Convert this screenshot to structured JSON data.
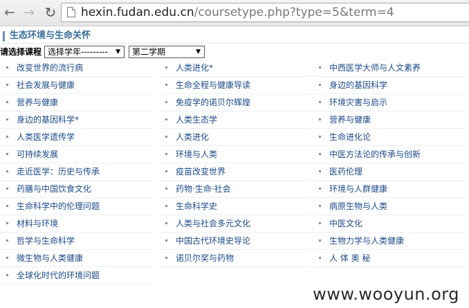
{
  "browser": {
    "url_host": "hexin.fudan.edu.cn",
    "url_path": "/coursetype.php?type=5&term=4"
  },
  "section": {
    "title": "生态环境与生命关怀"
  },
  "filter": {
    "label": "请选择课程",
    "year_value": "选择学年---------",
    "term_value": "第二学期"
  },
  "courses": [
    [
      "改变世界的流行病",
      "人类进化*",
      "中西医学大师与人文素养"
    ],
    [
      "社会发展与健康",
      "生命全程与健康导读",
      "身边的基因科学"
    ],
    [
      "营养与健康",
      "免疫学的诺贝尔辉煌",
      "环境灾害与启示"
    ],
    [
      "身边的基因科学*",
      "人类生态学",
      "营养与健康"
    ],
    [
      "人类医学遗传学",
      "人类进化",
      "生命进化论"
    ],
    [
      "可持续发展",
      "环境与人类",
      "中医方法论的传承与创新"
    ],
    [
      "走近医学：历史与传承",
      "疫苗改变世界",
      "医药伦理"
    ],
    [
      "药膳与中国饮食文化",
      "药物·生命·社会",
      "环境与人群健康"
    ],
    [
      "生命科学中的伦理问题",
      "生命科学史",
      "病原生物与人类"
    ],
    [
      "材料与环境",
      "人类与社会多元文化",
      "中医文化"
    ],
    [
      "哲学与生命科学",
      "中国古代环境史导论",
      "生物力学与人类健康"
    ],
    [
      "微生物与人类健康",
      "诺贝尔奖与药物",
      "人 体 奥 秘"
    ],
    [
      "全球化时代的环境问题"
    ]
  ],
  "watermark": "www.wooyun.org"
}
